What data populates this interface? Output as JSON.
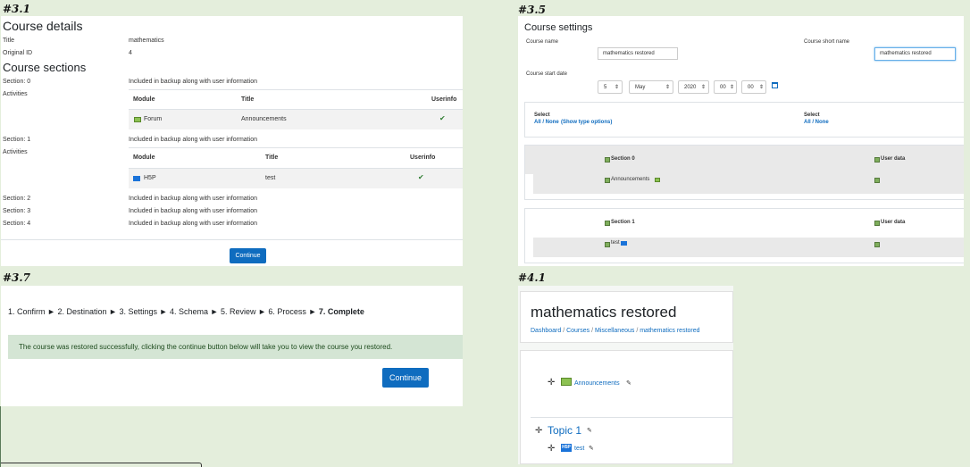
{
  "tags": {
    "p1": "#3.1",
    "p2": "#3.5",
    "p3": "#3.7",
    "p4": "#4.1"
  },
  "p31": {
    "course_details_heading": "Course details",
    "title_label": "Title",
    "title_value": "mathematics",
    "original_id_label": "Original ID",
    "original_id_value": "4",
    "course_sections_heading": "Course sections",
    "activities_label": "Activities",
    "included_text": "Included in backup along with user information",
    "columns": {
      "module": "Module",
      "title": "Title",
      "userinfo": "Userinfo"
    },
    "sections": [
      {
        "label": "Section: 0",
        "module": "Forum",
        "title": "Announcements"
      },
      {
        "label": "Section: 1",
        "module": "H5P",
        "title": "test"
      },
      {
        "label": "Section: 2"
      },
      {
        "label": "Section: 3"
      },
      {
        "label": "Section: 4"
      }
    ],
    "continue_button": "Continue"
  },
  "p35": {
    "heading": "Course settings",
    "course_name_label": "Course name",
    "course_name_value": "mathematics restored",
    "short_name_label": "Course short name",
    "short_name_value": "mathematics restored",
    "start_date_label": "Course start date",
    "date": {
      "day": "5",
      "month": "May",
      "year": "2020",
      "hour": "00",
      "minute": "00"
    },
    "select_label": "Select",
    "all_none": "All / None",
    "show_type_options": "(Show type options)",
    "section0": "Section 0",
    "section1": "Section 1",
    "user_data": "User data",
    "announcements": "Announcements",
    "test": "test"
  },
  "p37": {
    "steps": [
      "1. Confirm",
      "2. Destination",
      "3. Settings",
      "4. Schema",
      "5. Review",
      "6. Process",
      "7. Complete"
    ],
    "separator": "►",
    "success_message": "The course was restored successfully, clicking the continue button below will take you to view the course you restored.",
    "continue_button": "Continue"
  },
  "p41": {
    "title": "mathematics restored",
    "breadcrumb": [
      "Dashboard",
      "Courses",
      "Miscellaneous",
      "mathematics restored"
    ],
    "announcements": "Announcements",
    "topic": "Topic 1",
    "test": "test",
    "h5p_icon_text": "H5P"
  },
  "colors": {
    "accent": "#0f6cbf",
    "success_bg": "#d4e5d4",
    "page_bg": "#e4eedc"
  }
}
